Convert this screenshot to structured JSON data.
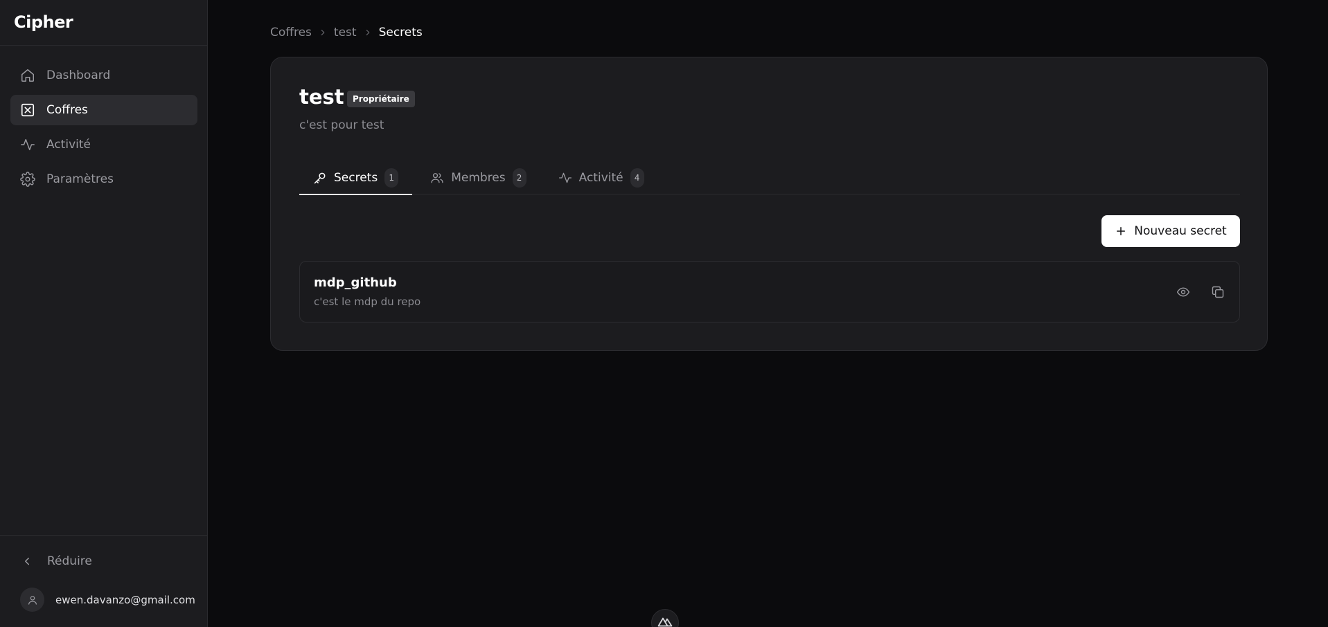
{
  "app": {
    "name": "Cipher"
  },
  "sidebar": {
    "items": [
      {
        "label": "Dashboard",
        "icon": "home-icon",
        "active": false
      },
      {
        "label": "Coffres",
        "icon": "vault-icon",
        "active": true
      },
      {
        "label": "Activité",
        "icon": "activity-icon",
        "active": false
      },
      {
        "label": "Paramètres",
        "icon": "settings-icon",
        "active": false
      }
    ],
    "collapse_label": "Réduire",
    "user_email": "ewen.davanzo@gmail.com"
  },
  "breadcrumb": {
    "items": [
      "Coffres",
      "test",
      "Secrets"
    ]
  },
  "vault": {
    "name": "test",
    "role": "Propriétaire",
    "description": "c'est pour test"
  },
  "tabs": [
    {
      "label": "Secrets",
      "count": "1",
      "icon": "key-icon",
      "active": true
    },
    {
      "label": "Membres",
      "count": "2",
      "icon": "users-icon",
      "active": false
    },
    {
      "label": "Activité",
      "count": "4",
      "icon": "activity-icon",
      "active": false
    }
  ],
  "actions": {
    "new_secret_label": "Nouveau secret"
  },
  "secrets": [
    {
      "name": "mdp_github",
      "description": "c'est le mdp du repo"
    }
  ],
  "colors": {
    "background": "#0b0b0d",
    "sidebar": "#1c1c1f",
    "card": "#1c1c1f",
    "primary_button": "#ffffff",
    "muted_text": "#8a8a90"
  }
}
